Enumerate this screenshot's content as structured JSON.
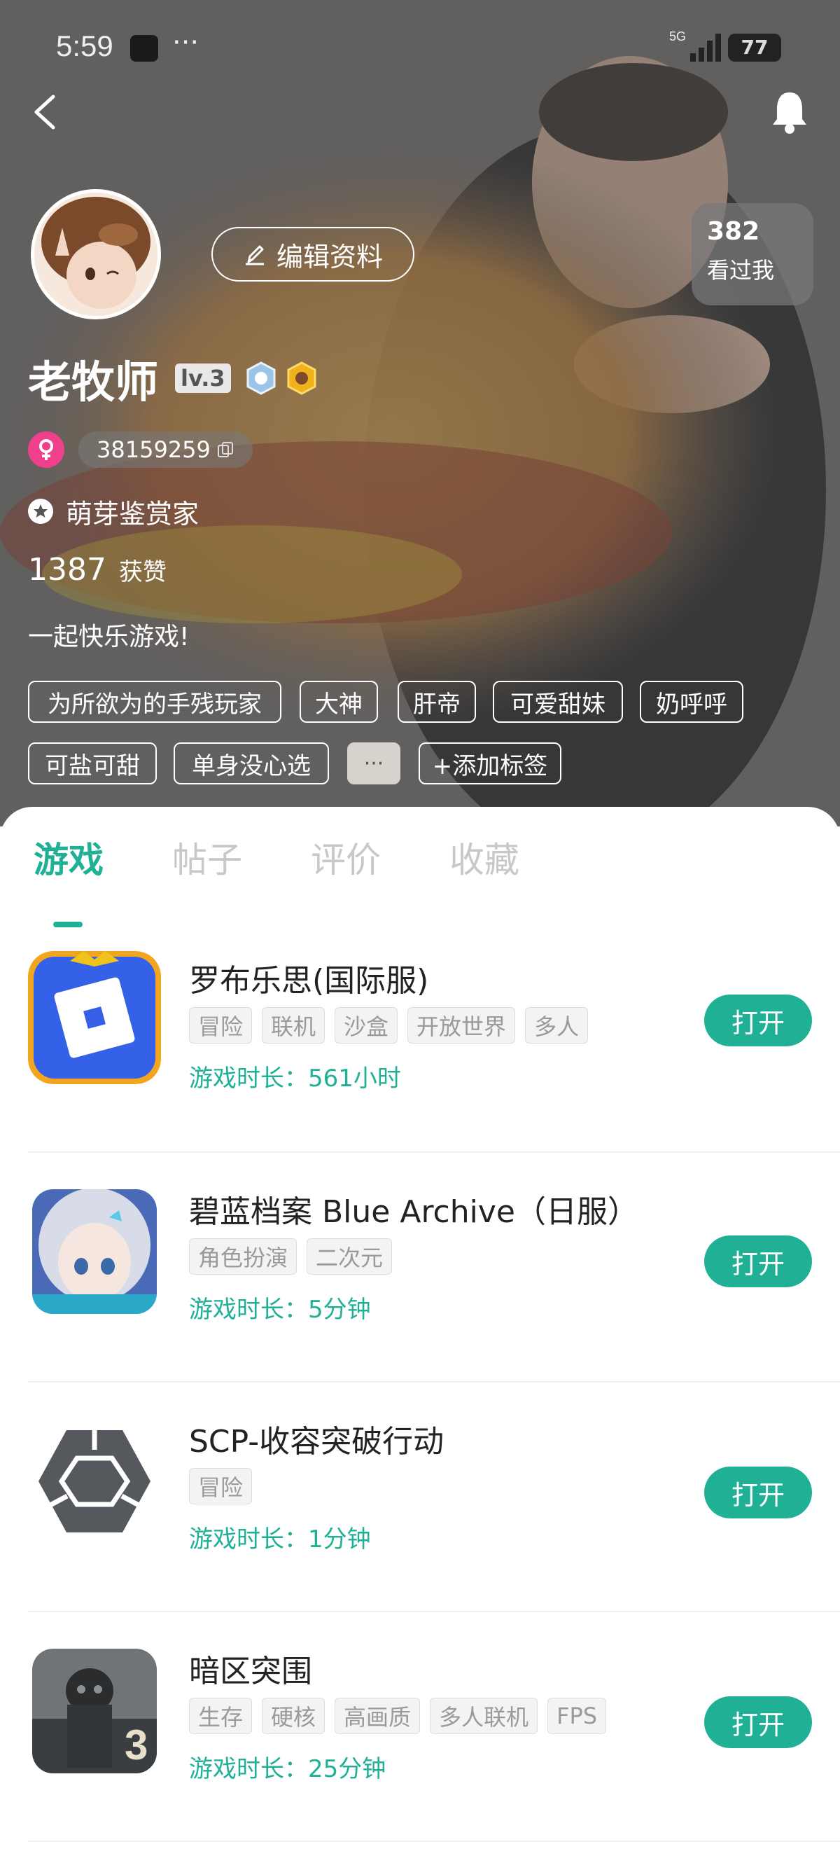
{
  "status_bar": {
    "time": "5:59",
    "dots": "···",
    "network": "5G",
    "battery": "77"
  },
  "profile": {
    "edit_label": "编辑资料",
    "visitors_count": "382",
    "visitors_label": "看过我",
    "name": "老牧师",
    "level": "lv.3",
    "uid": "38159259",
    "title": "萌芽鉴赏家",
    "likes_count": "1387",
    "likes_label": "获赞",
    "bio": "一起快乐游戏!",
    "tags": [
      "为所欲为的手残玩家",
      "大神",
      "肝帝",
      "可爱甜妹",
      "奶呼呼",
      "可盐可甜",
      "单身没心选"
    ],
    "more_tags": "···",
    "add_tag": "+添加标签"
  },
  "tabs": [
    "游戏",
    "帖子",
    "评价",
    "收藏"
  ],
  "games": [
    {
      "name": "罗布乐思(国际服)",
      "tags": [
        "冒险",
        "联机",
        "沙盒",
        "开放世界",
        "多人"
      ],
      "playtime": "游戏时长：561小时",
      "button": "打开"
    },
    {
      "name": "碧蓝档案 Blue Archive（日服）",
      "tags": [
        "角色扮演",
        "二次元"
      ],
      "playtime": "游戏时长：5分钟",
      "button": "打开"
    },
    {
      "name": "SCP-收容突破行动",
      "tags": [
        "冒险"
      ],
      "playtime": "游戏时长：1分钟",
      "button": "打开"
    },
    {
      "name": " 暗区突围",
      "tags": [
        "生存",
        "硬核",
        "高画质",
        "多人联机",
        "FPS"
      ],
      "playtime": "游戏时长：25分钟",
      "button": "打开"
    }
  ],
  "colors": {
    "accent": "#1fb096",
    "gender": "#f0408c"
  }
}
